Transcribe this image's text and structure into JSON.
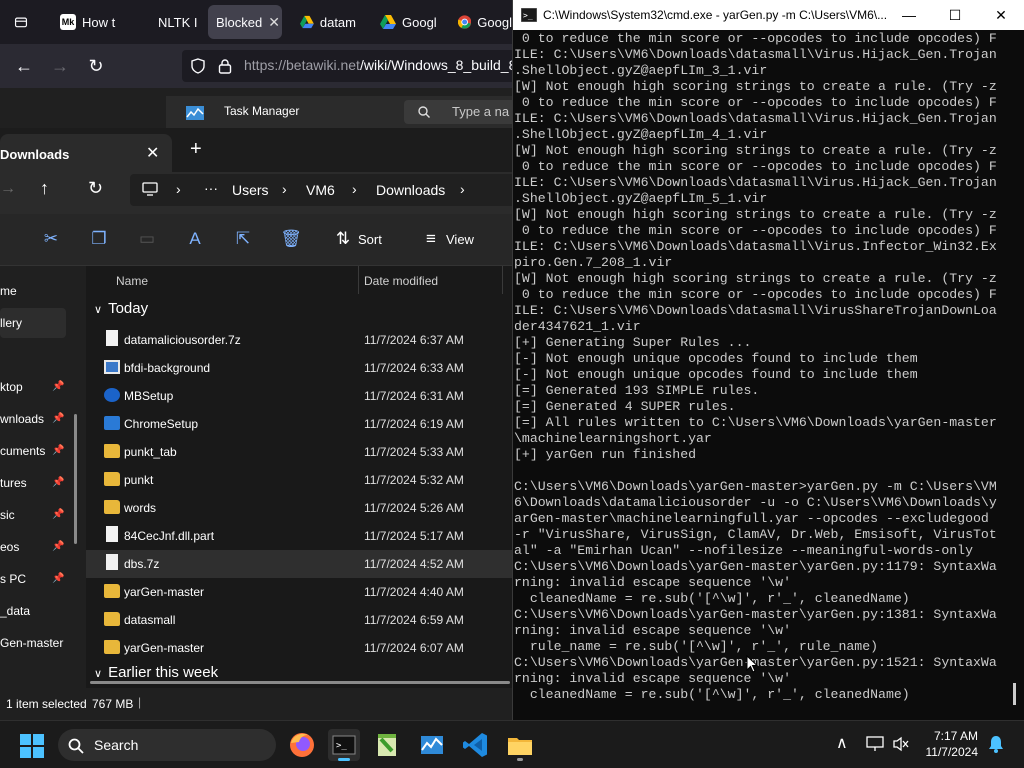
{
  "browser": {
    "tabs": [
      {
        "label": "How t",
        "favicon": "Mk"
      },
      {
        "label": "NLTK I",
        "favicon": ""
      },
      {
        "label": "Blocked",
        "favicon": ""
      },
      {
        "label": "datam",
        "favicon": "drive"
      },
      {
        "label": "Googl",
        "favicon": "drive"
      },
      {
        "label": "Googl",
        "favicon": "chrome"
      }
    ],
    "url_main": "https://betawiki.net",
    "url_path": "/wiki/Windows_8_build_8",
    "task_manager_title": "Task Manager",
    "task_manager_search": "Type a na"
  },
  "explorer": {
    "tab_title": "Downloads",
    "path": [
      "Users",
      "VM6",
      "Downloads"
    ],
    "sort_label": "Sort",
    "view_label": "View",
    "sidebar": [
      {
        "label": "me",
        "pinned": false
      },
      {
        "label": "llery",
        "pinned": false
      },
      {
        "label": "ktop",
        "pinned": true
      },
      {
        "label": "wnloads",
        "pinned": true
      },
      {
        "label": "cuments",
        "pinned": true
      },
      {
        "label": "tures",
        "pinned": true
      },
      {
        "label": "sic",
        "pinned": true
      },
      {
        "label": "eos",
        "pinned": true
      },
      {
        "label": "s PC",
        "pinned": true
      },
      {
        "label": "_data",
        "pinned": false
      },
      {
        "label": "Gen-master",
        "pinned": false
      }
    ],
    "columns": {
      "name": "Name",
      "date": "Date modified"
    },
    "group_today": "Today",
    "group_earlier": "Earlier this week",
    "files": [
      {
        "name": "datamaliciousorder.7z",
        "date": "11/7/2024 6:37 AM",
        "type": "doc"
      },
      {
        "name": "bfdi-background",
        "date": "11/7/2024 6:33 AM",
        "type": "image"
      },
      {
        "name": "MBSetup",
        "date": "11/7/2024 6:31 AM",
        "type": "setup"
      },
      {
        "name": "ChromeSetup",
        "date": "11/7/2024 6:19 AM",
        "type": "setup"
      },
      {
        "name": "punkt_tab",
        "date": "11/7/2024 5:33 AM",
        "type": "folder"
      },
      {
        "name": "punkt",
        "date": "11/7/2024 5:32 AM",
        "type": "folder"
      },
      {
        "name": "words",
        "date": "11/7/2024 5:26 AM",
        "type": "folder"
      },
      {
        "name": "84CecJnf.dll.part",
        "date": "11/7/2024 5:17 AM",
        "type": "doc"
      },
      {
        "name": "dbs.7z",
        "date": "11/7/2024 4:52 AM",
        "type": "doc",
        "selected": true
      },
      {
        "name": "yarGen-master",
        "date": "11/7/2024 4:40 AM",
        "type": "folder"
      },
      {
        "name": "datasmall",
        "date": "11/7/2024 6:59 AM",
        "type": "folder"
      },
      {
        "name": "yarGen-master",
        "date": "11/7/2024 6:07 AM",
        "type": "folder"
      }
    ],
    "status_selected": "1 item selected",
    "status_size": "767 MB"
  },
  "cmd": {
    "title": "C:\\Windows\\System32\\cmd.exe - yarGen.py  -m C:\\Users\\VM6\\...",
    "lines": [
      " 0 to reduce the min score or --opcodes to include opcodes) F",
      "ILE: C:\\Users\\VM6\\Downloads\\datasmall\\Virus.Hijack_Gen.Trojan",
      ".ShellObject.gyZ@aepfLIm_3_1.vir",
      "[W] Not enough high scoring strings to create a rule. (Try -z",
      " 0 to reduce the min score or --opcodes to include opcodes) F",
      "ILE: C:\\Users\\VM6\\Downloads\\datasmall\\Virus.Hijack_Gen.Trojan",
      ".ShellObject.gyZ@aepfLIm_4_1.vir",
      "[W] Not enough high scoring strings to create a rule. (Try -z",
      " 0 to reduce the min score or --opcodes to include opcodes) F",
      "ILE: C:\\Users\\VM6\\Downloads\\datasmall\\Virus.Hijack_Gen.Trojan",
      ".ShellObject.gyZ@aepfLIm_5_1.vir",
      "[W] Not enough high scoring strings to create a rule. (Try -z",
      " 0 to reduce the min score or --opcodes to include opcodes) F",
      "ILE: C:\\Users\\VM6\\Downloads\\datasmall\\Virus.Infector_Win32.Ex",
      "piro.Gen.7_208_1.vir",
      "[W] Not enough high scoring strings to create a rule. (Try -z",
      " 0 to reduce the min score or --opcodes to include opcodes) F",
      "ILE: C:\\Users\\VM6\\Downloads\\datasmall\\VirusShareTrojanDownLoa",
      "der4347621_1.vir",
      "[+] Generating Super Rules ...",
      "[-] Not enough unique opcodes found to include them",
      "[-] Not enough unique opcodes found to include them",
      "[=] Generated 193 SIMPLE rules.",
      "[=] Generated 4 SUPER rules.",
      "[=] All rules written to C:\\Users\\VM6\\Downloads\\yarGen-master",
      "\\machinelearningshort.yar",
      "[+] yarGen run finished",
      "",
      "C:\\Users\\VM6\\Downloads\\yarGen-master>yarGen.py -m C:\\Users\\VM",
      "6\\Downloads\\datamaliciousorder -u -o C:\\Users\\VM6\\Downloads\\y",
      "arGen-master\\machinelearningfull.yar --opcodes --excludegood",
      "-r \"VirusShare, VirusSign, ClamAV, Dr.Web, Emsisoft, VirusTot",
      "al\" -a \"Emirhan Ucan\" --nofilesize --meaningful-words-only",
      "C:\\Users\\VM6\\Downloads\\yarGen-master\\yarGen.py:1179: SyntaxWa",
      "rning: invalid escape sequence '\\w'",
      "  cleanedName = re.sub('[^\\w]', r'_', cleanedName)",
      "C:\\Users\\VM6\\Downloads\\yarGen-master\\yarGen.py:1381: SyntaxWa",
      "rning: invalid escape sequence '\\w'",
      "  rule_name = re.sub('[^\\w]', r'_', rule_name)",
      "C:\\Users\\VM6\\Downloads\\yarGen-master\\yarGen.py:1521: SyntaxWa",
      "rning: invalid escape sequence '\\w'",
      "  cleanedName = re.sub('[^\\w]', r'_', cleanedName)"
    ]
  },
  "taskbar": {
    "search_label": "Search",
    "time": "7:17 AM",
    "date": "11/7/2024"
  },
  "colors": {
    "folder": "#e8b73a",
    "accent": "#4cc2ff",
    "cmd_bg": "#0c0c0c",
    "cmd_text": "#cccccc"
  }
}
